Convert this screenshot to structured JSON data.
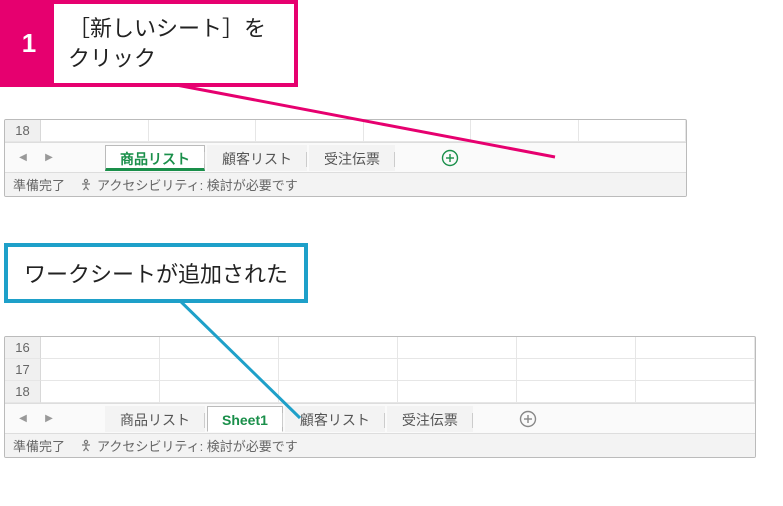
{
  "callout1": {
    "num": "1",
    "text_l1": "［新しいシート］を",
    "text_l2": "クリック"
  },
  "callout2": {
    "text": "ワークシートが追加された"
  },
  "panel1": {
    "rows": [
      "18"
    ],
    "tabs": {
      "t1": "商品リスト",
      "t2": "顧客リスト",
      "t3": "受注伝票"
    },
    "status": {
      "ready": "準備完了",
      "acc": "アクセシビリティ: 検討が必要です"
    }
  },
  "panel2": {
    "rows": [
      "16",
      "17",
      "18"
    ],
    "tabs": {
      "t1": "商品リスト",
      "t2": "Sheet1",
      "t3": "顧客リスト",
      "t4": "受注伝票"
    },
    "status": {
      "ready": "準備完了",
      "acc": "アクセシビリティ: 検討が必要です"
    }
  }
}
